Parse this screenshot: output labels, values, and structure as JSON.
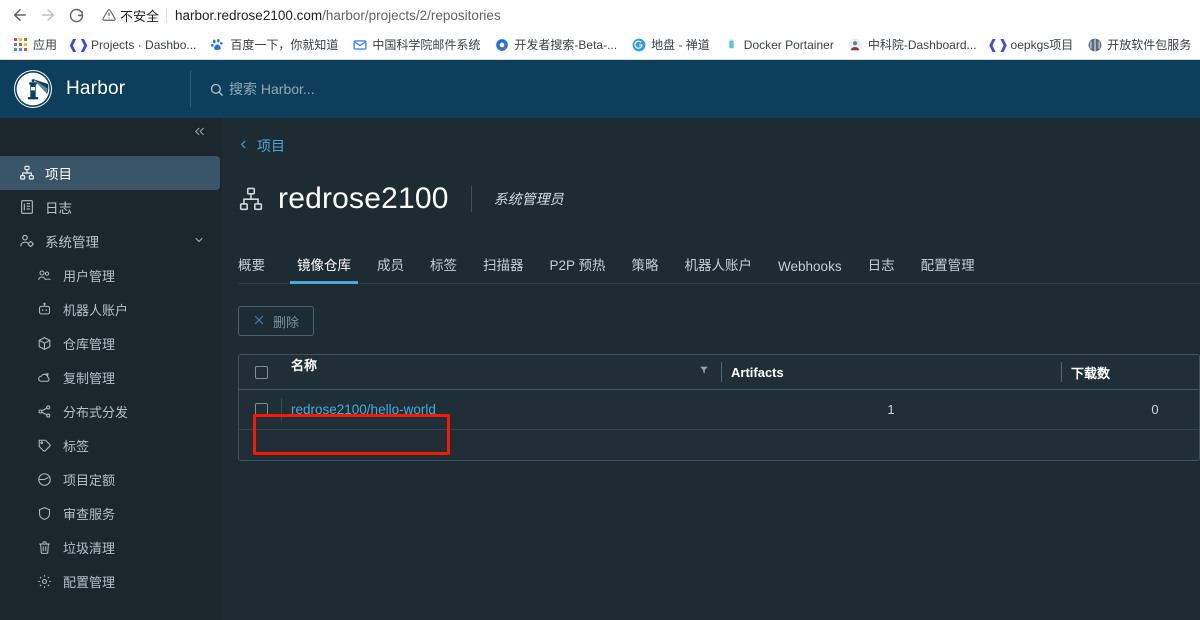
{
  "browser": {
    "nav": {
      "back_icon": "arrow-left-icon",
      "forward_icon": "arrow-right-icon",
      "reload_icon": "reload-icon"
    },
    "security": {
      "icon": "warning-triangle-icon",
      "label": "不安全"
    },
    "url": {
      "host": "harbor.redrose2100.com",
      "path": "/harbor/projects/2/repositories"
    },
    "bookmarks": [
      {
        "icon": "apps-grid-icon",
        "label": "应用"
      },
      {
        "icon": "gitlab-icon",
        "label": "Projects · Dashbo..."
      },
      {
        "icon": "baidu-icon",
        "label": "百度一下，你就知道"
      },
      {
        "icon": "mail-icon",
        "label": "中国科学院邮件系统"
      },
      {
        "icon": "dev-search-icon",
        "label": "开发者搜索-Beta-..."
      },
      {
        "icon": "zentao-icon",
        "label": "地盘 - 禅道"
      },
      {
        "icon": "docker-icon",
        "label": "Docker Portainer"
      },
      {
        "icon": "avatar-icon",
        "label": "中科院-Dashboard..."
      },
      {
        "icon": "gitlab-icon",
        "label": "oepkgs项目"
      },
      {
        "icon": "package-icon",
        "label": "开放软件包服务"
      }
    ]
  },
  "harbor": {
    "header": {
      "logo_icon": "harbor-lighthouse-icon",
      "brand": "Harbor",
      "search_icon": "search-icon",
      "search_placeholder": "搜索 Harbor..."
    },
    "sidebar": {
      "collapse_icon": "double-chevron-left-icon",
      "items": [
        {
          "label": "项目",
          "icon": "project-hierarchy-icon",
          "active": true,
          "sub": false,
          "chevron": false
        },
        {
          "label": "日志",
          "icon": "log-list-icon",
          "active": false,
          "sub": false,
          "chevron": false
        },
        {
          "label": "系统管理",
          "icon": "admin-gear-user-icon",
          "active": false,
          "sub": false,
          "chevron": true
        },
        {
          "label": "用户管理",
          "icon": "users-icon",
          "active": false,
          "sub": true,
          "chevron": false
        },
        {
          "label": "机器人账户",
          "icon": "robot-icon",
          "active": false,
          "sub": true,
          "chevron": false
        },
        {
          "label": "仓库管理",
          "icon": "cube-icon",
          "active": false,
          "sub": true,
          "chevron": false
        },
        {
          "label": "复制管理",
          "icon": "cloud-sync-icon",
          "active": false,
          "sub": true,
          "chevron": false
        },
        {
          "label": "分布式分发",
          "icon": "share-nodes-icon",
          "active": false,
          "sub": true,
          "chevron": false
        },
        {
          "label": "标签",
          "icon": "tag-icon",
          "active": false,
          "sub": true,
          "chevron": false
        },
        {
          "label": "项目定额",
          "icon": "pie-chart-icon",
          "active": false,
          "sub": true,
          "chevron": false
        },
        {
          "label": "审查服务",
          "icon": "shield-icon",
          "active": false,
          "sub": true,
          "chevron": false
        },
        {
          "label": "垃圾清理",
          "icon": "trash-icon",
          "active": false,
          "sub": true,
          "chevron": false
        },
        {
          "label": "配置管理",
          "icon": "gear-icon",
          "active": false,
          "sub": true,
          "chevron": false
        }
      ]
    },
    "main": {
      "back_link": "项目",
      "back_icon": "chevron-left-icon",
      "project_icon": "project-hierarchy-icon",
      "project_name": "redrose2100",
      "project_role": "系统管理员",
      "tabs": [
        {
          "label": "概要",
          "active": false
        },
        {
          "label": "镜像仓库",
          "active": true
        },
        {
          "label": "成员",
          "active": false
        },
        {
          "label": "标签",
          "active": false
        },
        {
          "label": "扫描器",
          "active": false
        },
        {
          "label": "P2P 预热",
          "active": false
        },
        {
          "label": "策略",
          "active": false
        },
        {
          "label": "机器人账户",
          "active": false
        },
        {
          "label": "Webhooks",
          "active": false
        },
        {
          "label": "日志",
          "active": false
        },
        {
          "label": "配置管理",
          "active": false
        }
      ],
      "toolbar": {
        "delete_label": "删除",
        "delete_icon": "close-x-icon",
        "delete_disabled": true
      },
      "table": {
        "select_all_icon": "checkbox-icon",
        "filter_icon": "funnel-icon",
        "columns": [
          {
            "key": "name",
            "label": "名称"
          },
          {
            "key": "artifacts",
            "label": "Artifacts"
          },
          {
            "key": "downloads",
            "label": "下载数"
          }
        ],
        "rows": [
          {
            "name": "redrose2100/hello-world",
            "artifacts": "1",
            "downloads": "0"
          }
        ]
      }
    }
  },
  "annotation": {
    "color": "#fb1800",
    "target": "repository-name-link"
  }
}
